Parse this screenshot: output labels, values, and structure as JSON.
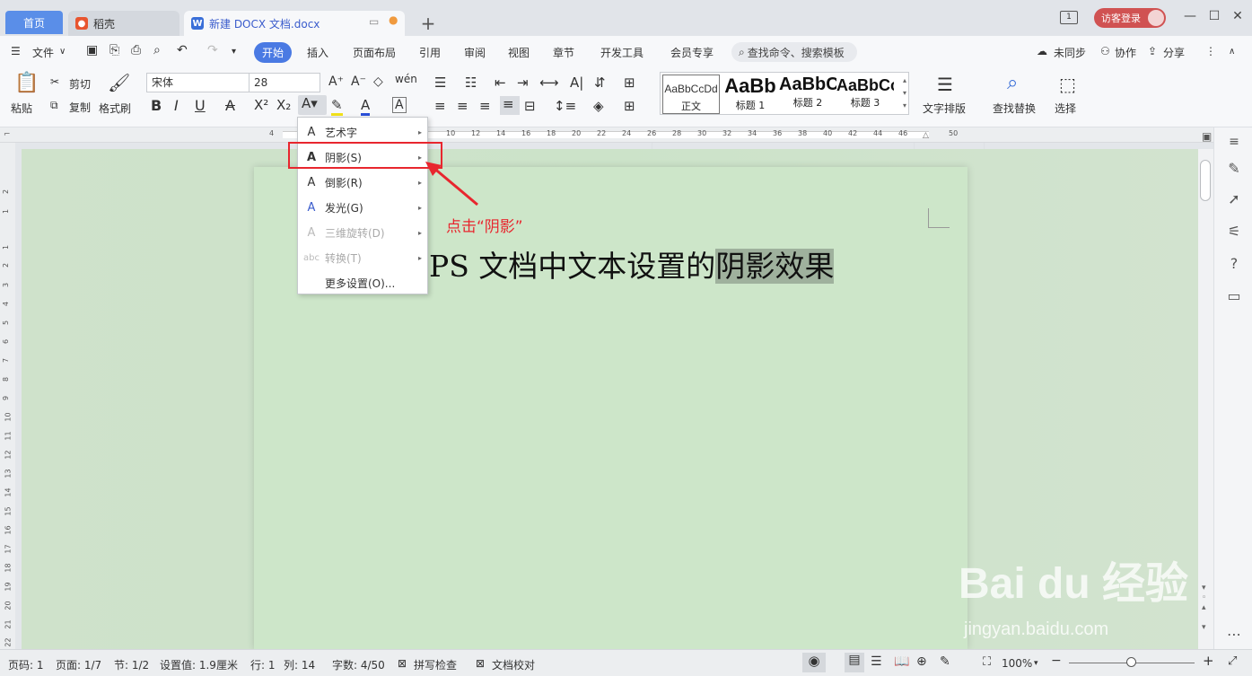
{
  "tabs": {
    "home": "首页",
    "daoke": "稻壳",
    "doc": "新建 DOCX 文档.docx",
    "add": "+"
  },
  "titlebar": {
    "monitor": "1",
    "login": "访客登录",
    "min": "—",
    "max": "☐",
    "close": "✕"
  },
  "menu": {
    "file": "文件",
    "items": [
      "开始",
      "插入",
      "页面布局",
      "引用",
      "审阅",
      "视图",
      "章节",
      "开发工具",
      "会员专享"
    ],
    "search": "查找命令、搜索模板",
    "sync": "未同步",
    "coop": "协作",
    "share": "分享"
  },
  "toolbar": {
    "paste": "粘贴",
    "cut": "剪切",
    "copy": "复制",
    "format_painter": "格式刷",
    "font": "宋体",
    "size": "28",
    "text_layout": "文字排版",
    "find_replace": "查找替换",
    "select": "选择"
  },
  "styles": [
    {
      "sample": "AaBbCcDd",
      "name": "正文"
    },
    {
      "sample": "AaBb",
      "name": "标题 1"
    },
    {
      "sample": "AaBbC",
      "name": "标题 2"
    },
    {
      "sample": "AaBbCc",
      "name": "标题 3"
    }
  ],
  "ruler": [
    "4",
    "10",
    "12",
    "14",
    "16",
    "18",
    "20",
    "22",
    "24",
    "26",
    "28",
    "30",
    "32",
    "34",
    "36",
    "38",
    "40",
    "42",
    "44",
    "46",
    "50"
  ],
  "vruler": [
    "2",
    "1",
    "1",
    "2",
    "3",
    "4",
    "5",
    "6",
    "7",
    "8",
    "9",
    "10",
    "11",
    "12",
    "13",
    "14",
    "15",
    "16",
    "17",
    "18",
    "19",
    "20",
    "21",
    "22"
  ],
  "dropdown": [
    {
      "icon": "A",
      "label": "艺术字",
      "arrow": "▸",
      "disabled": false
    },
    {
      "icon": "A",
      "label": "阴影(S)",
      "arrow": "▸",
      "disabled": false
    },
    {
      "icon": "A",
      "label": "倒影(R)",
      "arrow": "▸",
      "disabled": false
    },
    {
      "icon": "A",
      "label": "发光(G)",
      "arrow": "▸",
      "disabled": false
    },
    {
      "icon": "A",
      "label": "三维旋转(D)",
      "arrow": "▸",
      "disabled": true
    },
    {
      "icon": "abc",
      "label": "转换(T)",
      "arrow": "▸",
      "disabled": true
    },
    {
      "icon": "",
      "label": "更多设置(O)...",
      "arrow": "",
      "disabled": false
    }
  ],
  "annotation": "点击“阴影”",
  "document": {
    "text_plain": "PS 文档中文本设置的",
    "text_highlight": "阴影效果"
  },
  "status": {
    "page_code": "页码: 1",
    "page": "页面: 1/7",
    "section": "节: 1/2",
    "setting": "设置值: 1.9厘米",
    "row": "行: 1",
    "col": "列: 14",
    "words": "字数: 4/50",
    "spell": "拼写检查",
    "proof": "文档校对",
    "zoom": "100%"
  },
  "watermark": {
    "logo": "Bai du 经验",
    "url": "jingyan.baidu.com"
  }
}
